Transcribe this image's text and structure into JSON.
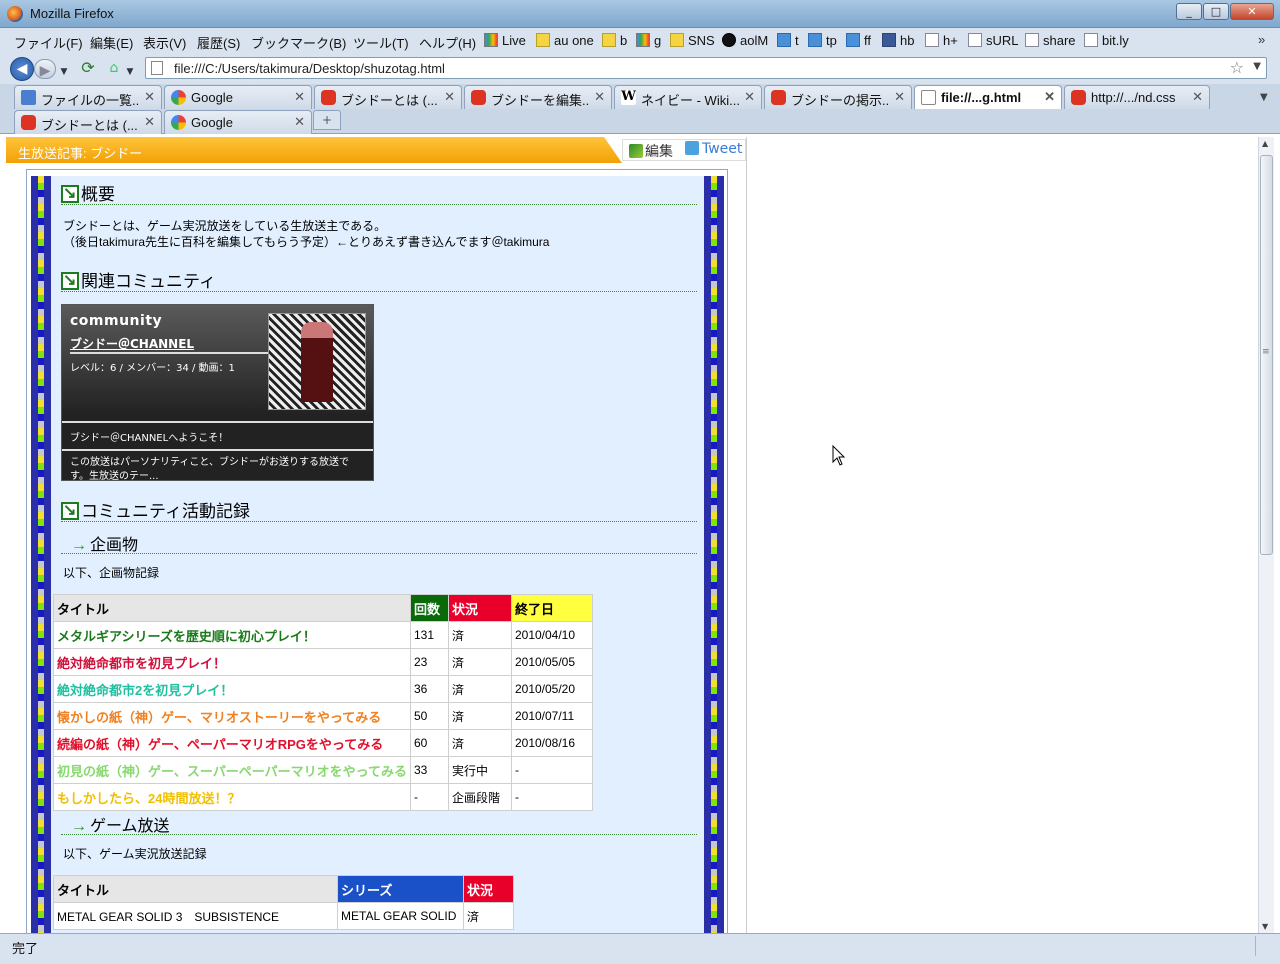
{
  "window": {
    "title": "Mozilla Firefox"
  },
  "menu": [
    "ファイル(F)",
    "編集(E)",
    "表示(V)",
    "履歴(S)",
    "ブックマーク(B)",
    "ツール(T)",
    "ヘルプ(H)"
  ],
  "bookmarks": [
    "Live",
    "au one",
    "b",
    "g",
    "SNS",
    "aolM",
    "t",
    "tp",
    "ff",
    "hb",
    "h+",
    "sURL",
    "share",
    "bit.ly"
  ],
  "address": {
    "url": "file:///C:/Users/takimura/Desktop/shuzotag.html"
  },
  "tabs_row1": [
    {
      "label": "ファイルの一覧...",
      "icon": "d"
    },
    {
      "label": "Google",
      "icon": "g"
    },
    {
      "label": "ブシドーとは (...",
      "icon": "r"
    },
    {
      "label": "ブシドーを編集...",
      "icon": "r"
    },
    {
      "label": "ネイビー - Wiki...",
      "icon": "w"
    },
    {
      "label": "ブシドーの掲示...",
      "icon": "r"
    },
    {
      "label": "file://...g.html",
      "icon": "f",
      "active": true
    },
    {
      "label": "http://.../nd.css",
      "icon": "r"
    }
  ],
  "tabs_row2": [
    {
      "label": "ブシドーとは (...",
      "icon": "r"
    },
    {
      "label": "Google",
      "icon": "g"
    }
  ],
  "article": {
    "header": "生放送記事: ブシドー",
    "edit": "編集",
    "tweet": "Tweet",
    "s1": {
      "title": "概要",
      "text1": "ブシドーとは、ゲーム実況放送をしている生放送主である。",
      "text2": "（後日takimura先生に百科を編集してもらう予定）←とりあえず書き込んでます＠takimura"
    },
    "s2": {
      "title": "関連コミュニティ"
    },
    "community": {
      "heading": "community",
      "name": "ブシドー＠CHANNEL",
      "stats": "レベル：6 / メンバー：34 / 動画：1",
      "welcome": "ブシドー＠CHANNELへようこそ！",
      "desc": "この放送はパーソナリティこと、ブシドーがお送りする放送です。生放送のテー..."
    },
    "s3": {
      "title": "コミュニティ活動記録"
    },
    "kikaku": {
      "title": "企画物",
      "intro": "以下、企画物記録"
    },
    "kikaku_table": {
      "headers": [
        "タイトル",
        "回数",
        "状況",
        "終了日"
      ],
      "rows": [
        {
          "title": "メタルギアシリーズを歴史順に初心プレイ！",
          "count": "131",
          "status": "済",
          "end": "2010/04/10",
          "color": "#1a7a1a"
        },
        {
          "title": "絶対絶命都市を初見プレイ！",
          "count": "23",
          "status": "済",
          "end": "2010/05/05",
          "color": "#d0103a"
        },
        {
          "title": "絶対絶命都市2を初見プレイ！",
          "count": "36",
          "status": "済",
          "end": "2010/05/20",
          "color": "#20c0a0"
        },
        {
          "title": "懐かしの紙（神）ゲー、マリオストーリーをやってみる",
          "count": "50",
          "status": "済",
          "end": "2010/07/11",
          "color": "#f08020"
        },
        {
          "title": "続編の紙（神）ゲー、ペーパーマリオRPGをやってみる",
          "count": "60",
          "status": "済",
          "end": "2010/08/16",
          "color": "#e0102a"
        },
        {
          "title": "初見の紙（神）ゲー、スーパーペーパーマリオをやってみる",
          "count": "33",
          "status": "実行中",
          "end": "-",
          "color": "#88d870"
        },
        {
          "title": "もしかしたら、24時間放送！？",
          "count": "-",
          "status": "企画段階",
          "end": "-",
          "color": "#f0c000"
        }
      ]
    },
    "game": {
      "title": "ゲーム放送",
      "intro": "以下、ゲーム実況放送記録"
    },
    "game_table": {
      "headers": [
        "タイトル",
        "シリーズ",
        "状況"
      ],
      "rows": [
        {
          "title": "METAL GEAR SOLID 3　SUBSISTENCE",
          "series": "METAL GEAR SOLID",
          "status": "済"
        }
      ]
    }
  },
  "colors": {
    "header_count_bg": "#0a6a0a",
    "header_status_bg": "#e8002a",
    "header_end_bg": "#ffff40",
    "header_series_bg": "#1a50c8"
  },
  "status": {
    "text": "完了"
  }
}
